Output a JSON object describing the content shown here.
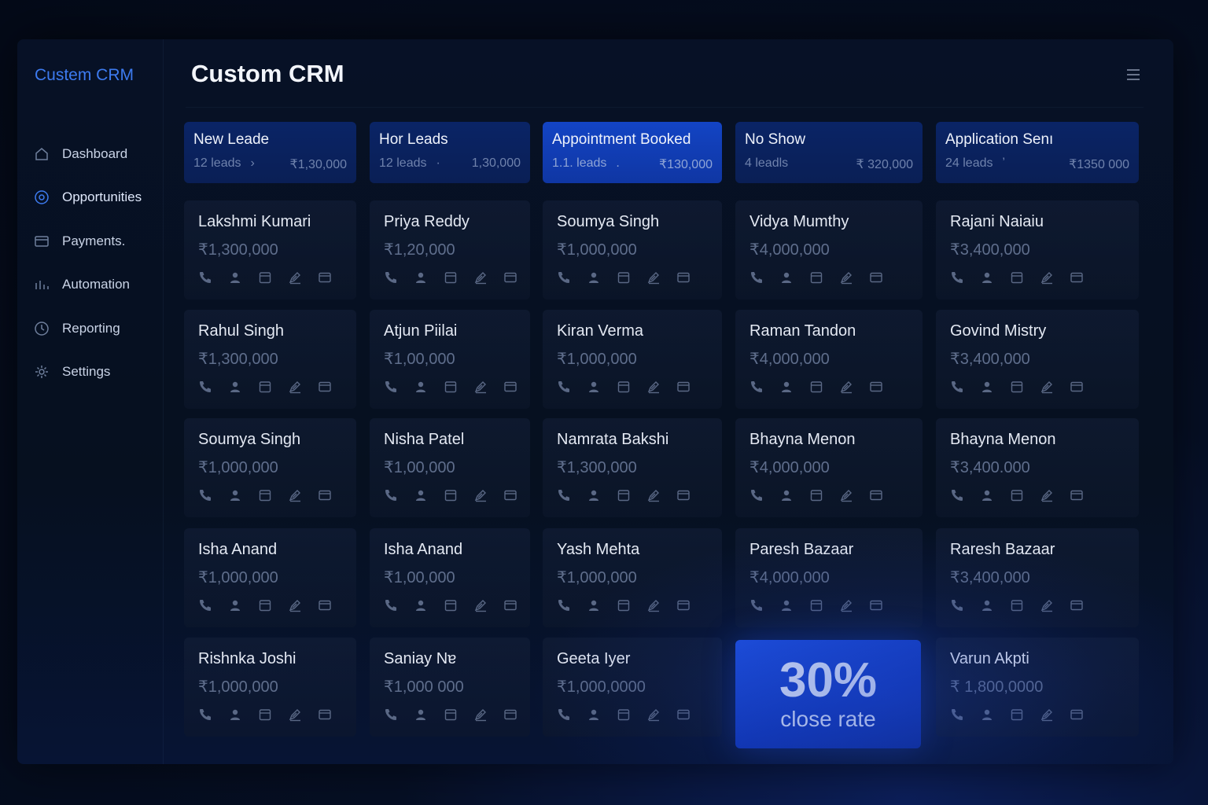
{
  "sidebar": {
    "brand": "Custem CRM",
    "items": [
      {
        "label": "Dashboard",
        "icon": "home-icon",
        "active": false
      },
      {
        "label": "Opportunities",
        "icon": "target-icon",
        "active": true
      },
      {
        "label": "Payments.",
        "icon": "card-icon",
        "active": false
      },
      {
        "label": "Automation",
        "icon": "bars-icon",
        "active": false
      },
      {
        "label": "Reporting",
        "icon": "clock-icon",
        "active": false
      },
      {
        "label": "Settings",
        "icon": "gear-icon",
        "active": false
      }
    ]
  },
  "header": {
    "title": "Custom CRM",
    "menu_icon": "hamburger-menu-icon"
  },
  "colors": {
    "accent": "#3d7bf0",
    "stage_bg": "#0a2466",
    "stage_highlight": "#1344c4",
    "stat_bg": "#1d4fe0"
  },
  "card_icons": [
    "phone-icon",
    "person-icon",
    "calendar-icon",
    "edit-icon",
    "card-icon"
  ],
  "columns": [
    {
      "title": "New Leade",
      "count": "12 leads",
      "dot": "›",
      "value": "₹1,30,000",
      "highlight": false,
      "cards": [
        {
          "name": "Lakshmi Kumari",
          "amount": "₹1,300,000"
        },
        {
          "name": "Rahul Singh",
          "amount": "₹1,300,000"
        },
        {
          "name": "Soumya Singh",
          "amount": "₹1,000,000"
        },
        {
          "name": "Isha Anand",
          "amount": "₹1,000,000"
        },
        {
          "name": "Rishnka Joshi",
          "amount": "₹1,000,000"
        }
      ]
    },
    {
      "title": "Hor Leads",
      "count": "12 leads",
      "dot": "·",
      "value": "1,30,000",
      "highlight": false,
      "cards": [
        {
          "name": "Priya Reddy",
          "amount": "₹1,20,000"
        },
        {
          "name": "Atjun Piilai",
          "amount": "₹1,00,000"
        },
        {
          "name": "Nisha Patel",
          "amount": "₹1,00,000"
        },
        {
          "name": "Isha Anand",
          "amount": "₹1,00,000"
        },
        {
          "name": "Saniay Nɐ",
          "amount": "₹1,000 000"
        }
      ]
    },
    {
      "title": "Appointment Booked",
      "count": "1.1. leads",
      "dot": ".",
      "value": "₹130,000",
      "highlight": true,
      "cards": [
        {
          "name": "Soumya Singh",
          "amount": "₹1,000,000"
        },
        {
          "name": "Kiran Verma",
          "amount": "₹1,000,000"
        },
        {
          "name": "Namrata Bakshi",
          "amount": "₹1,300,000"
        },
        {
          "name": "Yash Mehta",
          "amount": "₹1,000,000"
        },
        {
          "name": "Geeta Iyer",
          "amount": "₹1,000,0000"
        }
      ]
    },
    {
      "title": "No Show",
      "count": "4 leadls",
      "dot": "",
      "value": "₹ 320,000",
      "highlight": false,
      "cards": [
        {
          "name": "Vidya Mumthy",
          "amount": "₹4,000,000"
        },
        {
          "name": "Raman Tandon",
          "amount": "₹4,000,000"
        },
        {
          "name": "Bhayna Menon",
          "amount": "₹4,000,000"
        },
        {
          "name": "Paresh Bazaar",
          "amount": "₹4,000,000"
        }
      ],
      "stat": {
        "value": "30%",
        "label": "close rate"
      }
    },
    {
      "title": "Application Senı",
      "count": "24 leads",
      "dot": "ʼ",
      "value": "₹1350 000",
      "highlight": false,
      "cards": [
        {
          "name": "Rajani Naiaiu",
          "amount": "₹3,400,000"
        },
        {
          "name": "Govind Mistry",
          "amount": "₹3,400,000"
        },
        {
          "name": "Bhayna Menon",
          "amount": "₹3,400.000"
        },
        {
          "name": "Raresh Bazaar",
          "amount": "₹3,400,000"
        },
        {
          "name": "Varun Akpti",
          "amount": "₹ 1,800,0000"
        }
      ]
    }
  ]
}
